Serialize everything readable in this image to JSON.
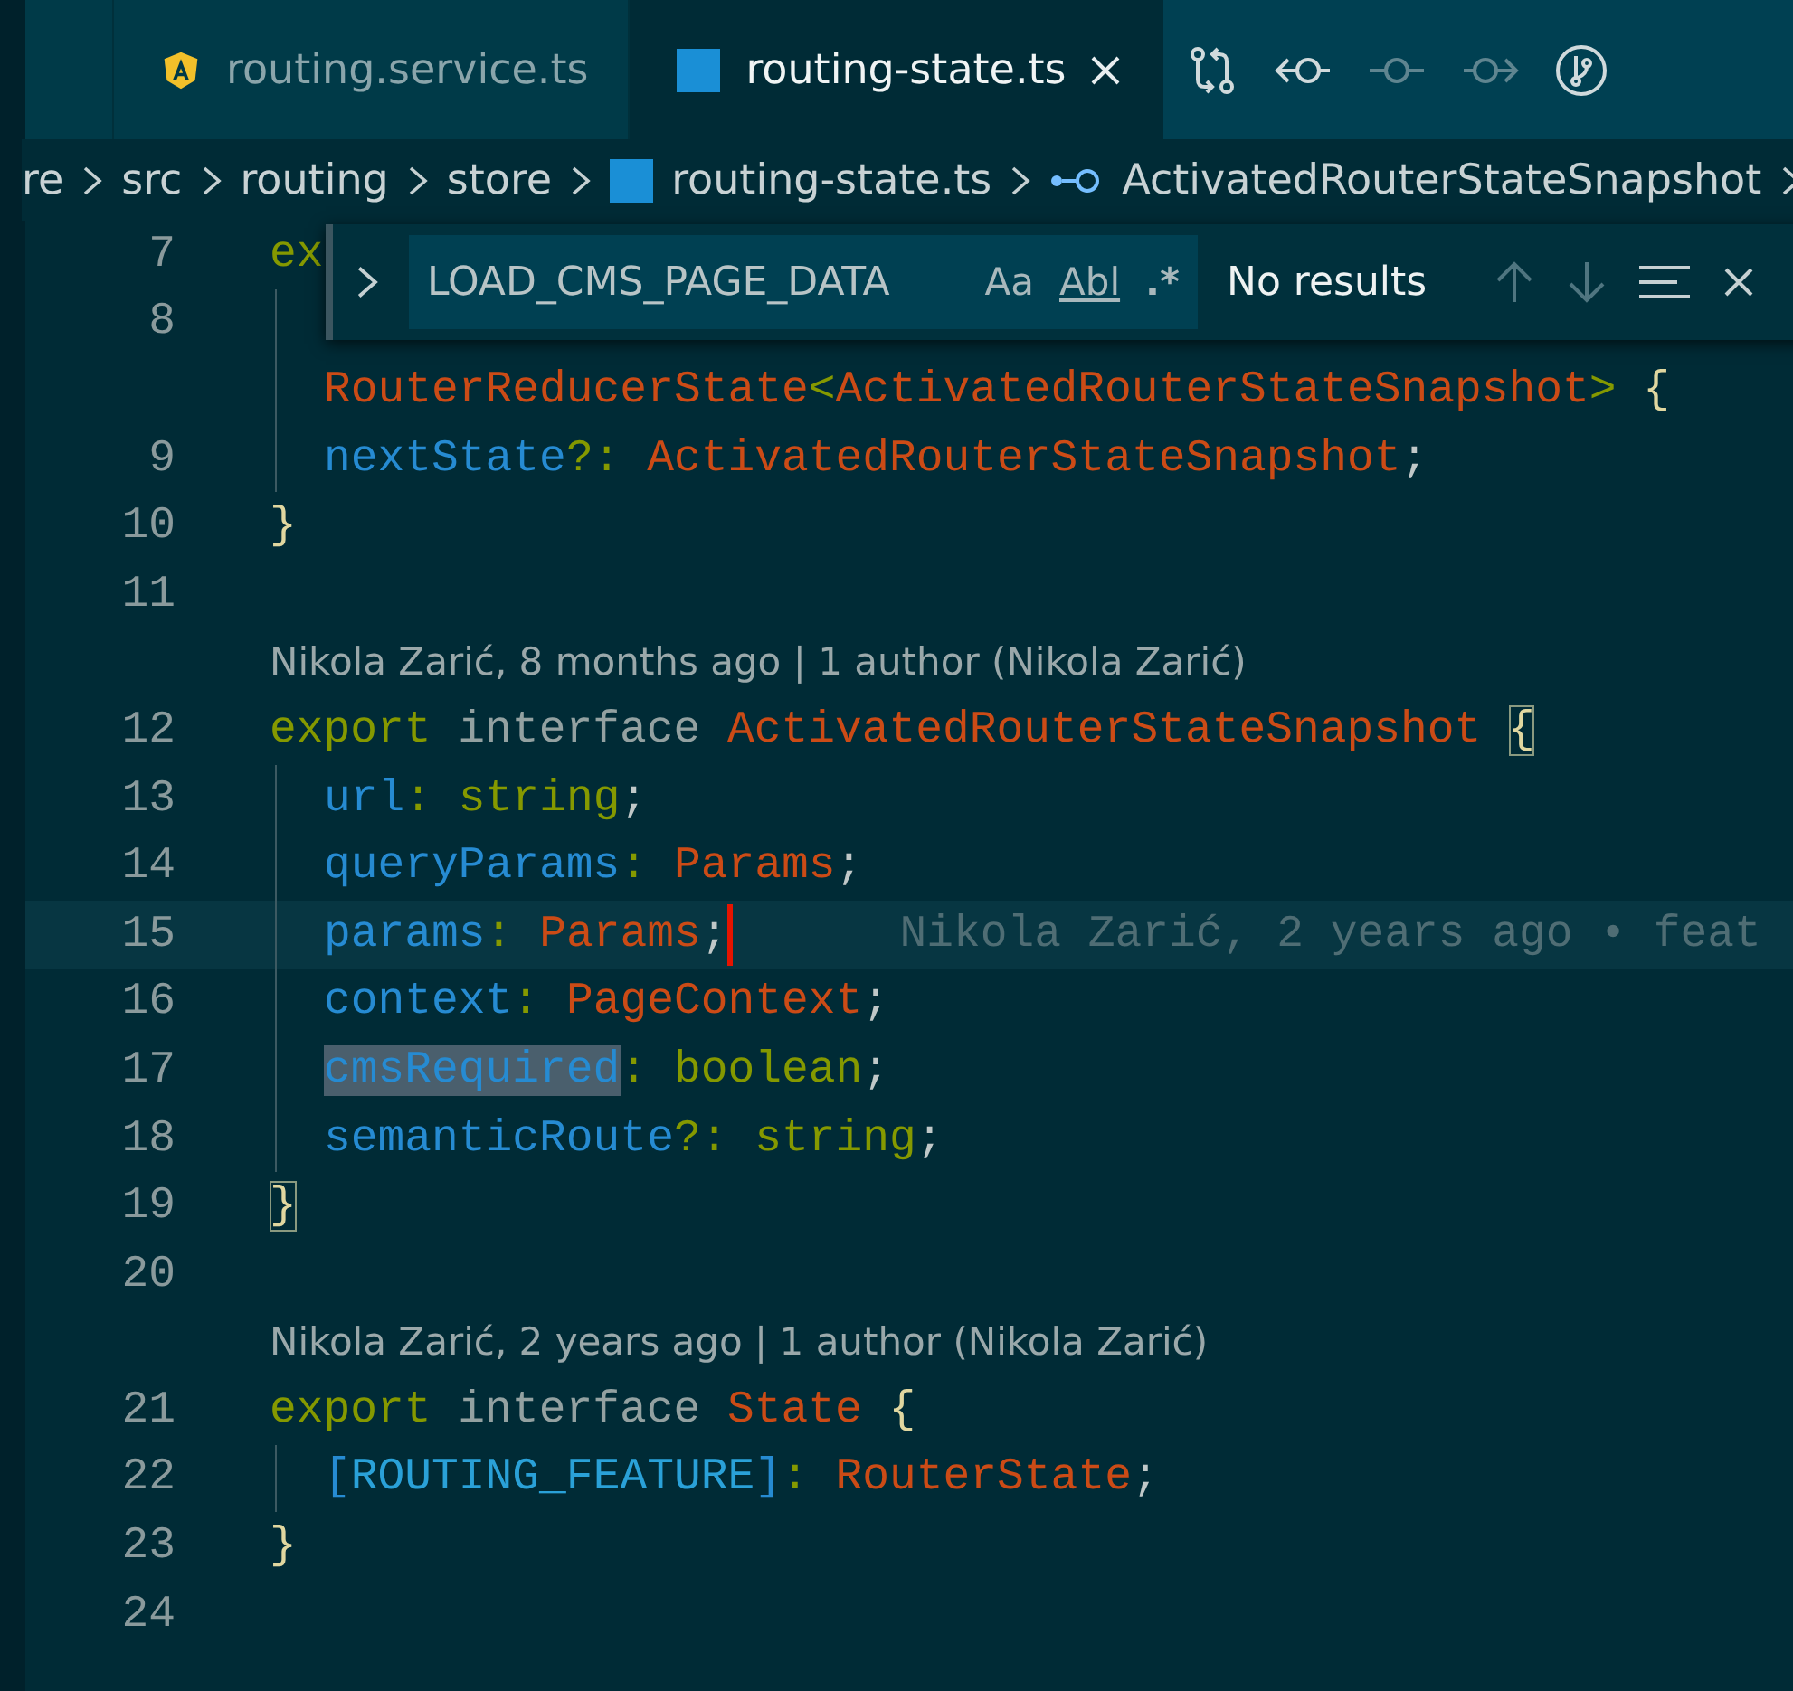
{
  "tabs": [
    {
      "label": "routing.service.ts",
      "kind": "angular",
      "selected": false
    },
    {
      "label": "routing-state.ts",
      "kind": "typescript",
      "selected": true
    }
  ],
  "breadcrumb": [
    {
      "label": "re",
      "kind": "folder"
    },
    {
      "label": "src",
      "kind": "folder"
    },
    {
      "label": "routing",
      "kind": "folder"
    },
    {
      "label": "store",
      "kind": "folder"
    },
    {
      "label": "routing-state.ts",
      "kind": "file"
    },
    {
      "label": "ActivatedRouterStateSnapshot",
      "kind": "symbol"
    }
  ],
  "find_widget": {
    "value": "LOAD_CMS_PAGE_DATA",
    "options": [
      {
        "label": "Aa",
        "kind": "case",
        "on": false
      },
      {
        "label": "Abl",
        "kind": "word",
        "on": false
      },
      {
        "label": ".*",
        "kind": "regex",
        "on": false
      }
    ],
    "result": "No results"
  },
  "lines": [
    {
      "kind": "code",
      "number": "7",
      "guide": false,
      "tokens": [
        {
          "text": "ex",
          "kind": "keyword"
        }
      ]
    },
    {
      "kind": "code",
      "number": "8",
      "guide": true
    },
    {
      "kind": "code",
      "guide": true,
      "tokens": [
        {
          "text": "RouterReducerState",
          "kind": "type"
        },
        {
          "text": "<",
          "kind": "punct"
        },
        {
          "text": "ActivatedRouterStateSnapshot",
          "kind": "type"
        },
        {
          "text": "> ",
          "kind": "punct"
        },
        {
          "text": "{",
          "kind": "bracket"
        }
      ]
    },
    {
      "kind": "code",
      "number": "9",
      "guide": true,
      "tokens": [
        {
          "text": "nextState",
          "kind": "prop"
        },
        {
          "text": "?: ",
          "kind": "punct"
        },
        {
          "text": "ActivatedRouterStateSnapshot",
          "kind": "type"
        },
        {
          "text": ";",
          "kind": "plain"
        }
      ]
    },
    {
      "kind": "code",
      "number": "10",
      "guide": false,
      "tokens": [
        {
          "text": "}",
          "kind": "bracket"
        }
      ]
    },
    {
      "kind": "code",
      "number": "11",
      "guide": false
    },
    {
      "kind": "lens",
      "text": "Nikola Zarić, 8 months ago | 1 author (Nikola Zarić)"
    },
    {
      "kind": "code",
      "number": "12",
      "guide": false,
      "tokens": [
        {
          "text": "export ",
          "kind": "keyword"
        },
        {
          "text": "interface ",
          "kind": "storage"
        },
        {
          "text": "ActivatedRouterStateSnapshot ",
          "kind": "type"
        },
        {
          "text": "{",
          "kind": "bracket",
          "matched": true
        }
      ]
    },
    {
      "kind": "code",
      "number": "13",
      "guide": true,
      "tokens": [
        {
          "text": "url",
          "kind": "prop"
        },
        {
          "text": ": ",
          "kind": "punct"
        },
        {
          "text": "string",
          "kind": "keyword"
        },
        {
          "text": ";",
          "kind": "plain"
        }
      ]
    },
    {
      "kind": "code",
      "number": "14",
      "guide": true,
      "tokens": [
        {
          "text": "queryParams",
          "kind": "prop"
        },
        {
          "text": ": ",
          "kind": "punct"
        },
        {
          "text": "Params",
          "kind": "type"
        },
        {
          "text": ";",
          "kind": "plain"
        }
      ]
    },
    {
      "kind": "code",
      "number": "15",
      "guide": true,
      "current": true,
      "tokens": [
        {
          "text": "params",
          "kind": "prop"
        },
        {
          "text": ": ",
          "kind": "punct"
        },
        {
          "text": "Params",
          "kind": "type"
        },
        {
          "text": ";",
          "kind": "plain"
        }
      ],
      "blame": "Nikola Zarić, 2 years ago • feat"
    },
    {
      "kind": "code",
      "number": "16",
      "guide": true,
      "tokens": [
        {
          "text": "context",
          "kind": "prop"
        },
        {
          "text": ": ",
          "kind": "punct"
        },
        {
          "text": "PageContext",
          "kind": "type"
        },
        {
          "text": ";",
          "kind": "plain"
        }
      ]
    },
    {
      "kind": "code",
      "number": "17",
      "guide": true,
      "tokens": [
        {
          "text": "cmsRequired",
          "kind": "prop",
          "highlighted": true
        },
        {
          "text": ": ",
          "kind": "punct"
        },
        {
          "text": "boolean",
          "kind": "keyword"
        },
        {
          "text": ";",
          "kind": "plain"
        }
      ]
    },
    {
      "kind": "code",
      "number": "18",
      "guide": true,
      "tokens": [
        {
          "text": "semanticRoute",
          "kind": "prop"
        },
        {
          "text": "?: ",
          "kind": "punct"
        },
        {
          "text": "string",
          "kind": "keyword"
        },
        {
          "text": ";",
          "kind": "plain"
        }
      ]
    },
    {
      "kind": "code",
      "number": "19",
      "guide": false,
      "tokens": [
        {
          "text": "}",
          "kind": "bracket",
          "matched": true
        }
      ]
    },
    {
      "kind": "code",
      "number": "20",
      "guide": false
    },
    {
      "kind": "lens",
      "text": "Nikola Zarić, 2 years ago | 1 author (Nikola Zarić)"
    },
    {
      "kind": "code",
      "number": "21",
      "guide": false,
      "tokens": [
        {
          "text": "export ",
          "kind": "keyword"
        },
        {
          "text": "interface ",
          "kind": "storage"
        },
        {
          "text": "State ",
          "kind": "type"
        },
        {
          "text": "{",
          "kind": "bracket"
        }
      ]
    },
    {
      "kind": "code",
      "number": "22",
      "guide": true,
      "tokens": [
        {
          "text": "[",
          "kind": "prop"
        },
        {
          "text": "ROUTING_FEATURE",
          "kind": "const"
        },
        {
          "text": "]",
          "kind": "prop"
        },
        {
          "text": ": ",
          "kind": "punct"
        },
        {
          "text": "RouterState",
          "kind": "type"
        },
        {
          "text": ";",
          "kind": "plain"
        }
      ]
    },
    {
      "kind": "code",
      "number": "23",
      "guide": false,
      "tokens": [
        {
          "text": "}",
          "kind": "bracket"
        }
      ]
    },
    {
      "kind": "code",
      "number": "24",
      "guide": false
    }
  ]
}
